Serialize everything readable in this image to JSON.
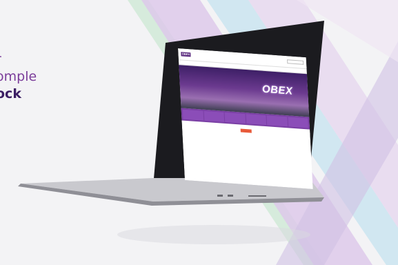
{
  "headline": {
    "lines": [
      "r",
      "omple",
      "ock"
    ]
  },
  "laptop_screen": {
    "logo": "OBEX",
    "tagline": "",
    "nav_items": [
      "",
      "",
      "",
      "",
      "",
      "",
      "",
      ""
    ],
    "hero_title": "OBEX",
    "hero_subtitle": "",
    "tiles": [
      "",
      "",
      "",
      "",
      "",
      ""
    ],
    "cta": "",
    "footer_text": ""
  },
  "colors": {
    "accent_purple": "#7b3d9a",
    "dark_purple": "#3b1e63",
    "tile_purple": "#8b4db8",
    "cta_orange": "#e85a3a",
    "stripe_green": "#cfe6d8",
    "stripe_lilac": "#d9c7e6",
    "stripe_blue": "#c5e3ef"
  }
}
